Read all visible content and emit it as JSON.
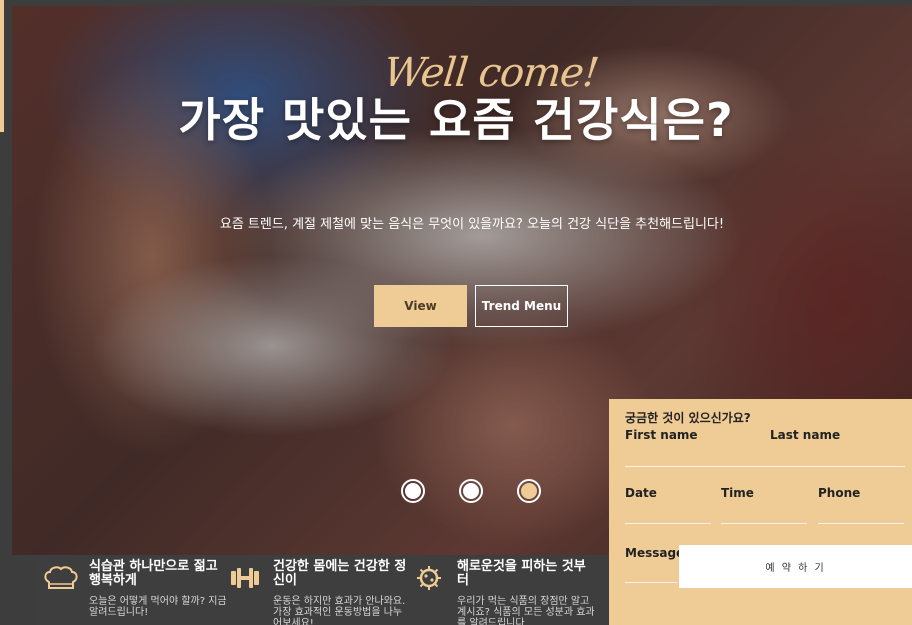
{
  "hero": {
    "script_title": "Well come!",
    "headline": "가장 맛있는 요즘 건강식은?",
    "subtext": "요즘 트렌드, 계절 제철에 맞는 음식은 무엇이 있을까요? 오늘의 건강 식단을 추천해드립니다!",
    "buttons": {
      "view": "View",
      "trend": "Trend Menu"
    },
    "slider": {
      "count": 3,
      "active_index": 2
    },
    "accent_color": "#efcb95"
  },
  "features": [
    {
      "icon": "chef-hat-icon",
      "title": "식습관 하나만으로 젊고 행복하게",
      "desc": "오늘은 어떻게 먹어야 할까? 지금 알려드립니다!"
    },
    {
      "icon": "dumbbell-icon",
      "title": "건강한 몸에는 건강한 정신이",
      "desc": "운동은 하지만 효과가 안나와요. 가장 효과적인 운동방법을 나누어보세요!"
    },
    {
      "icon": "virus-icon",
      "title": "해로운것을 피하는 것부터",
      "desc": "우리가 먹는 식품의 장점만 알고 계시죠? 식품의 모든 성분과 효과를 알려드립니다"
    }
  ],
  "form": {
    "question": "궁금한 것이 있으신가요?",
    "first_name": "First name",
    "last_name": "Last name",
    "date": "Date",
    "time": "Time",
    "phone": "Phone",
    "message": "Message",
    "submit": "예 약 하 기"
  }
}
